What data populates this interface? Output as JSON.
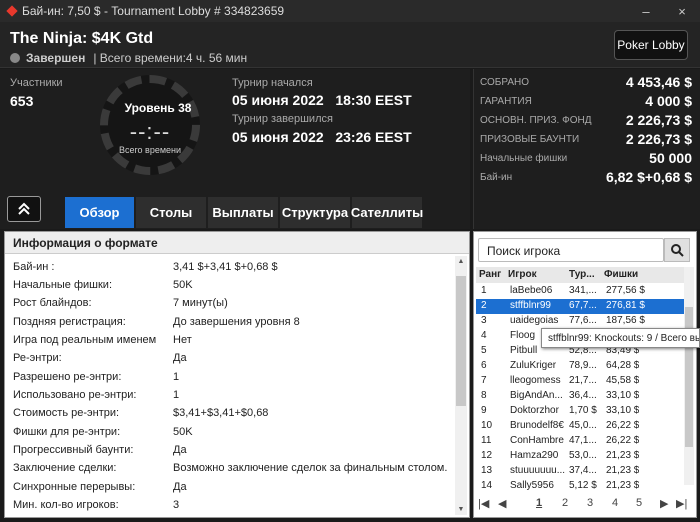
{
  "window": {
    "title": "Бай-ин: 7,50 $ - Tournament Lobby # 334823659",
    "minimize": "–",
    "close": "×"
  },
  "header": {
    "name": "The Ninja: $4K Gtd",
    "status": "Завершен",
    "total_time": "| Всего времени:4 ч. 56 мин",
    "poker_lobby": "Poker Lobby"
  },
  "info": {
    "participants_label": "Участники",
    "participants": "653",
    "level": "Уровень 38",
    "clock": "--:--",
    "total_label": "Всего времени",
    "started_label": "Турнир начался",
    "started": "05 июня 2022   18:30 EEST",
    "ended_label": "Турнир завершился",
    "ended": "05 июня 2022   23:26 EEST"
  },
  "prizes": [
    {
      "k": "СОБРАНО",
      "v": "4 453,46 $"
    },
    {
      "k": "ГАРАНТИЯ",
      "v": "4 000 $"
    },
    {
      "k": "ОСНОВН. ПРИЗ. ФОНД",
      "v": "2 226,73 $"
    },
    {
      "k": "ПРИЗОВЫЕ БАУНТИ",
      "v": "2 226,73 $"
    },
    {
      "k": "Начальные фишки",
      "v": "50 000"
    },
    {
      "k": "Бай-ин",
      "v": "6,82 $+0,68 $"
    }
  ],
  "tabs": [
    "Обзор",
    "Столы",
    "Выплаты",
    "Структура",
    "Сателлиты"
  ],
  "format": {
    "title": "Информация о формате",
    "rows": [
      {
        "k": "Бай-ин :",
        "v": "3,41 $+3,41 $+0,68 $"
      },
      {
        "k": "Начальные фишки:",
        "v": "50K"
      },
      {
        "k": "Рост блайндов:",
        "v": "7 минут(ы)"
      },
      {
        "k": "Поздняя регистрация:",
        "v": "До завершения уровня 8"
      },
      {
        "k": "Игра под реальным именем",
        "v": "Нет"
      },
      {
        "k": "Ре-энтри:",
        "v": "Да"
      },
      {
        "k": "Разрешено ре-энтри:",
        "v": "1"
      },
      {
        "k": "Использовано ре-энтри:",
        "v": "1"
      },
      {
        "k": "Стоимость ре-энтри:",
        "v": "$3,41+$3,41+$0,68"
      },
      {
        "k": "Фишки для ре-энтри:",
        "v": "50K"
      },
      {
        "k": "Прогрессивный баунти:",
        "v": "Да"
      },
      {
        "k": "Заключение сделки:",
        "v": "Возможно заключение сделок за финальным столом."
      },
      {
        "k": "Синхронные перерывы:",
        "v": "Да"
      },
      {
        "k": "Мин. кол-во игроков:",
        "v": "3"
      }
    ]
  },
  "players": {
    "search_placeholder": "Поиск игрока",
    "headers": [
      "Ранг",
      "Игрок",
      "Тур...",
      "Фишки"
    ],
    "rows": [
      [
        "1",
        "laBebe06",
        "341,...",
        "277,56 $"
      ],
      [
        "2",
        "stffblnr99",
        "67,7...",
        "276,81 $"
      ],
      [
        "3",
        "uaidegoias",
        "77,6...",
        "187,56 $"
      ],
      [
        "4",
        "Floog",
        "",
        ""
      ],
      [
        "5",
        "Pitbull",
        "52,8...",
        "83,49 $"
      ],
      [
        "6",
        "ZuluKriger",
        "78,9...",
        "64,28 $"
      ],
      [
        "7",
        "lleogomess",
        "21,7...",
        "45,58 $"
      ],
      [
        "8",
        "BigAndAn...",
        "36,4...",
        "33,10 $"
      ],
      [
        "9",
        "Doktorzhor",
        "1,70 $",
        "33,10 $"
      ],
      [
        "10",
        "Brunodelf8€",
        "45,0...",
        "26,22 $"
      ],
      [
        "11",
        "ConHambre",
        "47,1...",
        "26,22 $"
      ],
      [
        "12",
        "Hamza290",
        "53,0...",
        "21,23 $"
      ],
      [
        "13",
        "stuuuuuuu...",
        "37,4...",
        "21,23 $"
      ],
      [
        "14",
        "Sally5956",
        "5,12 $",
        "21,23 $"
      ]
    ],
    "pages": [
      "1",
      "2",
      "3",
      "4",
      "5"
    ],
    "tooltip": "stffblnr99: Knockouts: 9 / Всего вы"
  }
}
